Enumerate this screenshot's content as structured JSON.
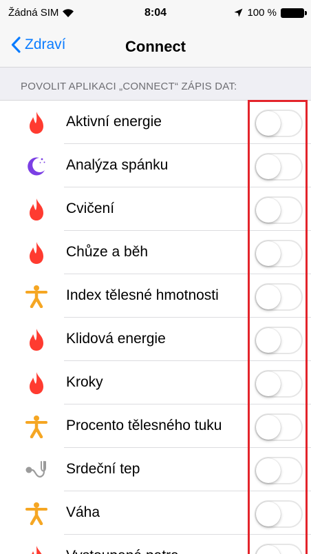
{
  "status_bar": {
    "carrier": "Žádná SIM",
    "time": "8:04",
    "battery": "100 %"
  },
  "nav": {
    "back_label": "Zdraví",
    "title": "Connect"
  },
  "section": {
    "header": "POVOLIT APLIKACI „CONNECT“ ZÁPIS DAT:"
  },
  "items": [
    {
      "label": "Aktivní energie",
      "icon": "flame-icon",
      "on": false
    },
    {
      "label": "Analýza spánku",
      "icon": "moon-icon",
      "on": false
    },
    {
      "label": "Cvičení",
      "icon": "flame-icon",
      "on": false
    },
    {
      "label": "Chůze a běh",
      "icon": "flame-icon",
      "on": false
    },
    {
      "label": "Index tělesné hmotnosti",
      "icon": "person-icon",
      "on": false
    },
    {
      "label": "Klidová energie",
      "icon": "flame-icon",
      "on": false
    },
    {
      "label": "Kroky",
      "icon": "flame-icon",
      "on": false
    },
    {
      "label": "Procento tělesného tuku",
      "icon": "person-icon",
      "on": false
    },
    {
      "label": "Srdeční tep",
      "icon": "stethoscope-icon",
      "on": false
    },
    {
      "label": "Váha",
      "icon": "person-icon",
      "on": false
    },
    {
      "label": "Vystoupaná patra",
      "icon": "flame-icon",
      "on": false
    }
  ],
  "colors": {
    "accent": "#0a7cff",
    "flame": "#ff3b30",
    "moon": "#7b3fe4",
    "person": "#f5a623",
    "stethoscope": "#9b9b9b",
    "highlight": "#e3242b"
  }
}
